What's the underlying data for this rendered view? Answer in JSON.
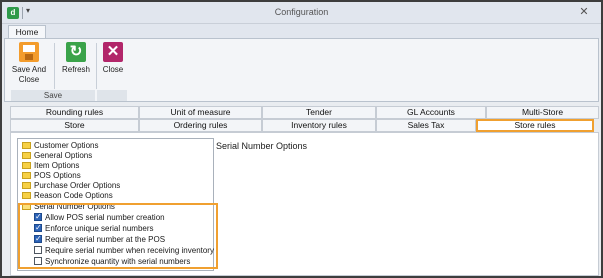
{
  "window": {
    "title": "Configuration",
    "app_icon": "d-app-icon",
    "qat_dropdown": "▾",
    "close_glyph": "✕"
  },
  "ribbon": {
    "tab": "Home",
    "buttons": [
      {
        "label": "Save And Close",
        "icon": "save-icon"
      },
      {
        "label": "Refresh",
        "icon": "refresh-icon"
      },
      {
        "label": "Close",
        "icon": "close-icon"
      }
    ],
    "group_label": "Save"
  },
  "tabs": {
    "row1": [
      "Rounding rules",
      "Unit of measure",
      "Tender",
      "GL Accounts",
      "Multi-Store"
    ],
    "row2": [
      "Store",
      "Ordering rules",
      "Inventory rules",
      "Sales Tax",
      "Store rules"
    ],
    "active": "Store rules",
    "highlight_color": "#f0a030"
  },
  "tree": {
    "folders": [
      "Customer Options",
      "General Options",
      "Item Options",
      "POS Options",
      "Purchase Order Options",
      "Reason Code Options",
      "Serial Number Options"
    ],
    "serial_children": [
      {
        "label": "Allow POS serial number creation",
        "checked": true
      },
      {
        "label": "Enforce unique serial numbers",
        "checked": true
      },
      {
        "label": "Require serial number at the POS",
        "checked": true
      },
      {
        "label": "Require serial number when receiving inventory",
        "checked": false
      },
      {
        "label": "Synchronize quantity with serial numbers",
        "checked": false
      }
    ]
  },
  "panel": {
    "title": "Serial Number Options"
  }
}
